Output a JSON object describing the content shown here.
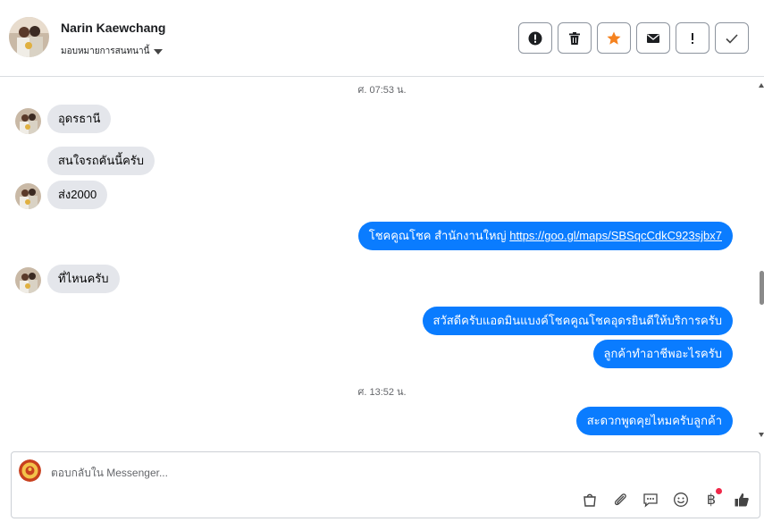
{
  "header": {
    "name": "Narin Kaewchang",
    "assign_label": "มอบหมายการสนทนานี้"
  },
  "actions": [
    {
      "name": "spam-button",
      "icon": "alert-circle-icon"
    },
    {
      "name": "delete-button",
      "icon": "trash-icon"
    },
    {
      "name": "star-button",
      "icon": "star-icon"
    },
    {
      "name": "mark-unread-button",
      "icon": "envelope-icon"
    },
    {
      "name": "follow-up-button",
      "icon": "exclamation-icon"
    },
    {
      "name": "mark-done-button",
      "icon": "check-icon"
    }
  ],
  "conversation": {
    "timestamp1": "ศ. 07:53 น.",
    "timestamp2": "ศ. 13:52 น.",
    "messages": [
      {
        "dir": "in",
        "text": "อุดรธานี"
      },
      {
        "dir": "in",
        "text": "สนใจรถคันนี้ครับ"
      },
      {
        "dir": "in",
        "text": "ส่ง2000"
      },
      {
        "dir": "out",
        "text": "โชคคูณโชค สำนักงานใหญ่ ",
        "link": "https://goo.gl/maps/SBSqcCdkC923sjbx7"
      },
      {
        "dir": "in",
        "text": "ที่ไหนครับ"
      },
      {
        "dir": "out",
        "text": "สวัสดีครับแอดมินแบงค์โชคคูณโชคอุดรยินดีให้บริการครับ"
      },
      {
        "dir": "out",
        "text": "ลูกค้าทำอาชีพอะไรครับ"
      },
      {
        "dir": "out",
        "text": "สะดวกพูดคุยไหมครับลูกค้า"
      }
    ]
  },
  "composer": {
    "placeholder": "ตอบกลับใน Messenger..."
  },
  "colors": {
    "outgoing_bubble": "#0a7cff",
    "incoming_bubble": "#e4e6eb",
    "star": "#f5821f"
  }
}
